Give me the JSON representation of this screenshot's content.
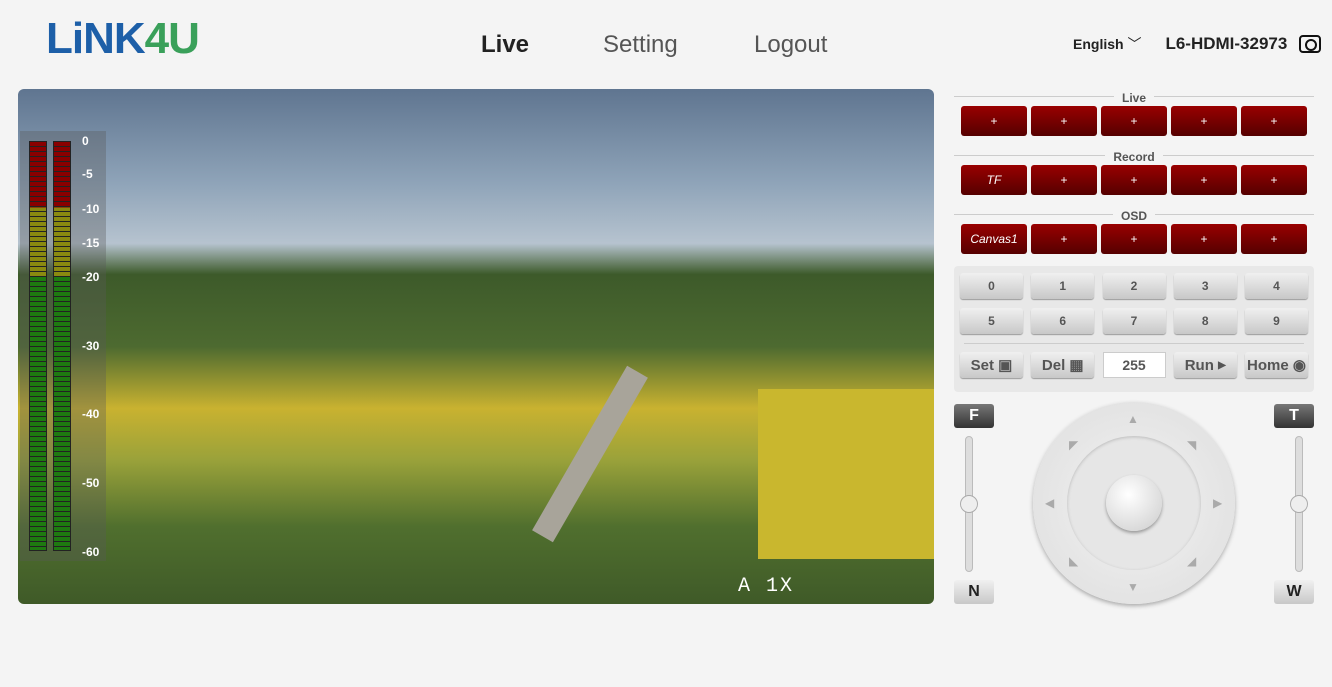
{
  "header": {
    "logo_part1": "LiNK",
    "logo_part2": "4U",
    "nav": [
      "Live",
      "Setting",
      "Logout"
    ],
    "language": "English",
    "device_name": "L6-HDMI-32973"
  },
  "video": {
    "meter_labels": [
      "0",
      "-5",
      "-10",
      "-15",
      "-20",
      "-30",
      "-40",
      "-50",
      "-60"
    ],
    "zoom_overlay": "A 1X"
  },
  "panel": {
    "live_title": "Live",
    "live_buttons": [
      "+",
      "+",
      "+",
      "+",
      "+"
    ],
    "record_title": "Record",
    "record_buttons": [
      "TF",
      "+",
      "+",
      "+",
      "+"
    ],
    "osd_title": "OSD",
    "osd_buttons": [
      "Canvas1",
      "+",
      "+",
      "+",
      "+"
    ],
    "presets": [
      "0",
      "1",
      "2",
      "3",
      "4",
      "5",
      "6",
      "7",
      "8",
      "9"
    ],
    "set": "Set",
    "del": "Del",
    "preset_value": "255",
    "run": "Run",
    "home": "Home",
    "focus_far": "F",
    "focus_near": "N",
    "zoom_tele": "T",
    "zoom_wide": "W"
  }
}
